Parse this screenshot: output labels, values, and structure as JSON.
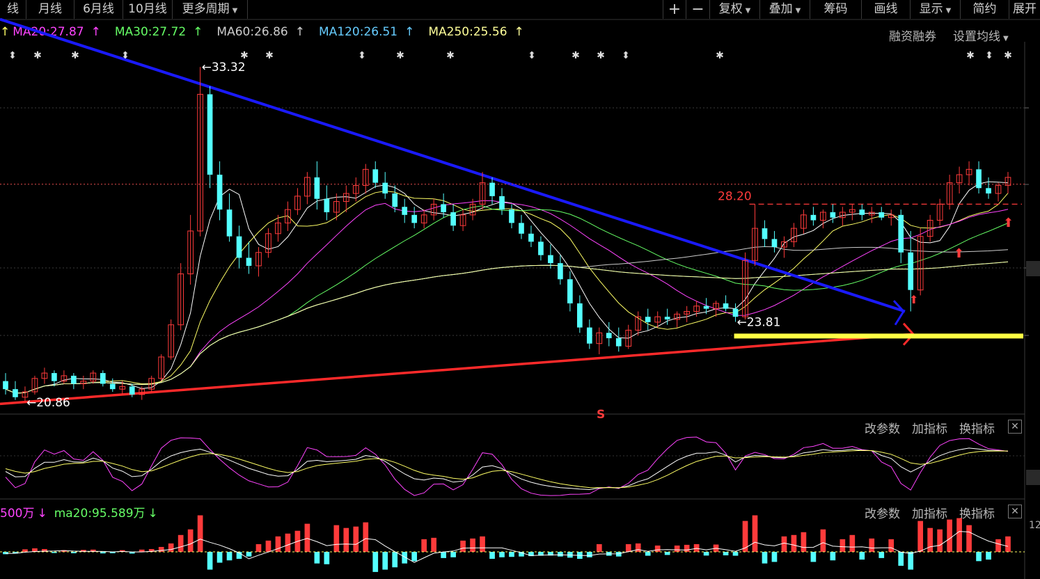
{
  "toolbar": {
    "items": [
      "线",
      "月线",
      "6月线",
      "10月线",
      "更多周期"
    ],
    "right_items": [
      "复权",
      "叠加",
      "筹码",
      "画线",
      "显示",
      "简约",
      "展开"
    ],
    "plus": "+",
    "minus": "−"
  },
  "ma_legend": {
    "ma20": "MA20:27.87",
    "ma30": "MA30:27.72",
    "ma60": "MA60:26.86",
    "ma120": "MA120:26.51",
    "ma250": "MA250:25.56",
    "lead_arrow": "↑",
    "up_arrow": "↑"
  },
  "right_links": {
    "margin": "融资融券",
    "set_ma": "设置均线"
  },
  "annotations": {
    "high": "33.32",
    "low": "20.86",
    "level_28": "28.20",
    "level_23": "23.81",
    "s_marker": "S"
  },
  "indicator_controls": {
    "edit": "改参数",
    "add": "加指标",
    "switch": "换指标",
    "close": "✕"
  },
  "volume_legend": {
    "vol": "500万",
    "vol_arrow": "↓",
    "ma20": "ma20:95.589万",
    "ma20_arrow": "↓",
    "axis_label": "12"
  },
  "colors": {
    "up": "#ff3b3b",
    "down": "#54ffff",
    "ma5": "#ffffff",
    "ma10": "#ffff66",
    "ma20": "#ff44ff",
    "ma30": "#66ff66",
    "ma60": "#cccccc",
    "ma120": "#66ccff",
    "ma250": "#ffff99",
    "trend_blue": "#1a1aff",
    "trend_red": "#ff2a2a",
    "support_yellow": "#ffff44"
  },
  "chart_data": {
    "type": "candlestick",
    "title": "",
    "price_ylim": [
      20.5,
      34.0
    ],
    "ma_values": {
      "MA20": 27.87,
      "MA30": 27.72,
      "MA60": 26.86,
      "MA120": 26.51,
      "MA250": 25.56
    },
    "key_levels": [
      {
        "label": "33.32",
        "value": 33.32
      },
      {
        "label": "20.86",
        "value": 20.86
      },
      {
        "label": "28.20",
        "value": 28.2
      },
      {
        "label": "23.81",
        "value": 23.81
      }
    ],
    "bars": [
      {
        "o": 21.6,
        "h": 21.9,
        "l": 21.1,
        "c": 21.3
      },
      {
        "o": 21.3,
        "h": 21.6,
        "l": 20.9,
        "c": 21.0
      },
      {
        "o": 21.0,
        "h": 21.4,
        "l": 20.86,
        "c": 21.2
      },
      {
        "o": 21.2,
        "h": 21.8,
        "l": 21.1,
        "c": 21.7
      },
      {
        "o": 21.7,
        "h": 22.1,
        "l": 21.5,
        "c": 21.9
      },
      {
        "o": 21.9,
        "h": 22.0,
        "l": 21.4,
        "c": 21.6
      },
      {
        "o": 21.6,
        "h": 22.0,
        "l": 21.5,
        "c": 21.8
      },
      {
        "o": 21.8,
        "h": 21.9,
        "l": 21.3,
        "c": 21.5
      },
      {
        "o": 21.5,
        "h": 21.8,
        "l": 21.3,
        "c": 21.6
      },
      {
        "o": 21.6,
        "h": 22.0,
        "l": 21.5,
        "c": 21.9
      },
      {
        "o": 21.9,
        "h": 22.0,
        "l": 21.4,
        "c": 21.5
      },
      {
        "o": 21.5,
        "h": 21.7,
        "l": 21.2,
        "c": 21.3
      },
      {
        "o": 21.3,
        "h": 21.6,
        "l": 21.1,
        "c": 21.4
      },
      {
        "o": 21.4,
        "h": 21.5,
        "l": 21.0,
        "c": 21.1
      },
      {
        "o": 21.1,
        "h": 21.4,
        "l": 20.9,
        "c": 21.3
      },
      {
        "o": 21.3,
        "h": 21.8,
        "l": 21.2,
        "c": 21.7
      },
      {
        "o": 21.7,
        "h": 22.6,
        "l": 21.6,
        "c": 22.5
      },
      {
        "o": 22.5,
        "h": 23.9,
        "l": 22.4,
        "c": 23.7
      },
      {
        "o": 23.7,
        "h": 26.0,
        "l": 23.5,
        "c": 25.6
      },
      {
        "o": 25.6,
        "h": 27.8,
        "l": 25.2,
        "c": 27.2
      },
      {
        "o": 27.2,
        "h": 33.32,
        "l": 27.0,
        "c": 32.3
      },
      {
        "o": 32.3,
        "h": 32.6,
        "l": 28.8,
        "c": 29.3
      },
      {
        "o": 29.3,
        "h": 29.8,
        "l": 27.6,
        "c": 28.0
      },
      {
        "o": 28.0,
        "h": 28.6,
        "l": 26.8,
        "c": 27.0
      },
      {
        "o": 27.0,
        "h": 27.4,
        "l": 25.8,
        "c": 26.2
      },
      {
        "o": 26.2,
        "h": 26.8,
        "l": 25.6,
        "c": 25.9
      },
      {
        "o": 25.9,
        "h": 26.6,
        "l": 25.5,
        "c": 26.4
      },
      {
        "o": 26.4,
        "h": 27.3,
        "l": 26.2,
        "c": 27.1
      },
      {
        "o": 27.1,
        "h": 27.8,
        "l": 26.8,
        "c": 27.5
      },
      {
        "o": 27.5,
        "h": 28.3,
        "l": 27.2,
        "c": 28.0
      },
      {
        "o": 28.0,
        "h": 28.8,
        "l": 27.8,
        "c": 28.5
      },
      {
        "o": 28.5,
        "h": 29.4,
        "l": 28.2,
        "c": 29.2
      },
      {
        "o": 29.2,
        "h": 29.8,
        "l": 28.0,
        "c": 28.4
      },
      {
        "o": 28.4,
        "h": 28.9,
        "l": 27.6,
        "c": 27.9
      },
      {
        "o": 27.9,
        "h": 28.6,
        "l": 27.6,
        "c": 28.3
      },
      {
        "o": 28.3,
        "h": 28.9,
        "l": 27.9,
        "c": 28.6
      },
      {
        "o": 28.6,
        "h": 29.2,
        "l": 28.3,
        "c": 28.9
      },
      {
        "o": 28.9,
        "h": 29.7,
        "l": 28.6,
        "c": 29.5
      },
      {
        "o": 29.5,
        "h": 29.8,
        "l": 28.8,
        "c": 29.0
      },
      {
        "o": 29.0,
        "h": 29.4,
        "l": 28.4,
        "c": 28.6
      },
      {
        "o": 28.6,
        "h": 28.9,
        "l": 27.9,
        "c": 28.1
      },
      {
        "o": 28.1,
        "h": 28.4,
        "l": 27.5,
        "c": 27.8
      },
      {
        "o": 27.8,
        "h": 28.1,
        "l": 27.3,
        "c": 27.5
      },
      {
        "o": 27.5,
        "h": 28.0,
        "l": 27.3,
        "c": 27.8
      },
      {
        "o": 27.8,
        "h": 28.4,
        "l": 27.6,
        "c": 28.2
      },
      {
        "o": 28.2,
        "h": 28.6,
        "l": 27.7,
        "c": 27.9
      },
      {
        "o": 27.9,
        "h": 28.2,
        "l": 27.2,
        "c": 27.4
      },
      {
        "o": 27.4,
        "h": 28.0,
        "l": 27.2,
        "c": 27.8
      },
      {
        "o": 27.8,
        "h": 28.4,
        "l": 27.6,
        "c": 28.2
      },
      {
        "o": 28.2,
        "h": 29.4,
        "l": 28.0,
        "c": 29.0
      },
      {
        "o": 29.0,
        "h": 29.2,
        "l": 28.2,
        "c": 28.5
      },
      {
        "o": 28.5,
        "h": 28.8,
        "l": 27.8,
        "c": 28.0
      },
      {
        "o": 28.0,
        "h": 28.2,
        "l": 27.3,
        "c": 27.5
      },
      {
        "o": 27.5,
        "h": 27.8,
        "l": 26.9,
        "c": 27.1
      },
      {
        "o": 27.1,
        "h": 27.4,
        "l": 26.6,
        "c": 26.8
      },
      {
        "o": 26.8,
        "h": 27.0,
        "l": 26.1,
        "c": 26.3
      },
      {
        "o": 26.3,
        "h": 26.7,
        "l": 25.8,
        "c": 26.0
      },
      {
        "o": 26.0,
        "h": 26.3,
        "l": 25.2,
        "c": 25.4
      },
      {
        "o": 25.4,
        "h": 25.7,
        "l": 24.2,
        "c": 24.5
      },
      {
        "o": 24.5,
        "h": 24.8,
        "l": 23.4,
        "c": 23.6
      },
      {
        "o": 23.6,
        "h": 23.9,
        "l": 22.8,
        "c": 23.0
      },
      {
        "o": 23.0,
        "h": 23.6,
        "l": 22.6,
        "c": 23.4
      },
      {
        "o": 23.4,
        "h": 23.8,
        "l": 22.9,
        "c": 23.2
      },
      {
        "o": 23.2,
        "h": 23.6,
        "l": 22.7,
        "c": 22.9
      },
      {
        "o": 22.9,
        "h": 23.7,
        "l": 22.8,
        "c": 23.5
      },
      {
        "o": 23.5,
        "h": 24.2,
        "l": 23.3,
        "c": 24.0
      },
      {
        "o": 24.0,
        "h": 24.3,
        "l": 23.5,
        "c": 23.8
      },
      {
        "o": 23.8,
        "h": 24.2,
        "l": 23.6,
        "c": 24.0
      },
      {
        "o": 24.0,
        "h": 24.3,
        "l": 23.7,
        "c": 23.9
      },
      {
        "o": 23.9,
        "h": 24.2,
        "l": 23.6,
        "c": 24.1
      },
      {
        "o": 24.1,
        "h": 24.4,
        "l": 23.8,
        "c": 24.2
      },
      {
        "o": 24.2,
        "h": 24.6,
        "l": 24.0,
        "c": 24.4
      },
      {
        "o": 24.4,
        "h": 24.7,
        "l": 24.1,
        "c": 24.3
      },
      {
        "o": 24.3,
        "h": 24.6,
        "l": 24.0,
        "c": 24.5
      },
      {
        "o": 24.5,
        "h": 24.8,
        "l": 24.2,
        "c": 24.3
      },
      {
        "o": 24.3,
        "h": 24.5,
        "l": 23.81,
        "c": 24.0
      },
      {
        "o": 24.0,
        "h": 26.4,
        "l": 23.9,
        "c": 26.1
      },
      {
        "o": 26.1,
        "h": 28.2,
        "l": 25.9,
        "c": 27.3
      },
      {
        "o": 27.3,
        "h": 27.6,
        "l": 26.6,
        "c": 26.9
      },
      {
        "o": 26.9,
        "h": 27.2,
        "l": 26.4,
        "c": 26.6
      },
      {
        "o": 26.6,
        "h": 27.0,
        "l": 26.2,
        "c": 26.8
      },
      {
        "o": 26.8,
        "h": 27.5,
        "l": 26.6,
        "c": 27.3
      },
      {
        "o": 27.3,
        "h": 28.0,
        "l": 27.1,
        "c": 27.8
      },
      {
        "o": 27.8,
        "h": 28.1,
        "l": 27.4,
        "c": 27.6
      },
      {
        "o": 27.6,
        "h": 28.0,
        "l": 27.3,
        "c": 27.9
      },
      {
        "o": 27.9,
        "h": 28.2,
        "l": 27.5,
        "c": 27.7
      },
      {
        "o": 27.7,
        "h": 28.1,
        "l": 27.4,
        "c": 27.9
      },
      {
        "o": 27.9,
        "h": 28.2,
        "l": 27.6,
        "c": 28.0
      },
      {
        "o": 28.0,
        "h": 28.2,
        "l": 27.6,
        "c": 27.8
      },
      {
        "o": 27.8,
        "h": 28.1,
        "l": 27.5,
        "c": 27.9
      },
      {
        "o": 27.9,
        "h": 28.1,
        "l": 27.6,
        "c": 27.7
      },
      {
        "o": 27.7,
        "h": 28.0,
        "l": 27.4,
        "c": 27.8
      },
      {
        "o": 27.8,
        "h": 28.0,
        "l": 26.0,
        "c": 26.4
      },
      {
        "o": 26.4,
        "h": 27.2,
        "l": 24.2,
        "c": 25.0
      },
      {
        "o": 25.0,
        "h": 27.3,
        "l": 24.8,
        "c": 27.0
      },
      {
        "o": 27.0,
        "h": 27.8,
        "l": 26.8,
        "c": 27.6
      },
      {
        "o": 27.6,
        "h": 28.4,
        "l": 27.4,
        "c": 28.2
      },
      {
        "o": 28.2,
        "h": 29.3,
        "l": 28.0,
        "c": 29.0
      },
      {
        "o": 29.0,
        "h": 29.6,
        "l": 28.6,
        "c": 29.3
      },
      {
        "o": 29.3,
        "h": 29.8,
        "l": 28.9,
        "c": 29.5
      },
      {
        "o": 29.5,
        "h": 29.8,
        "l": 28.6,
        "c": 28.8
      },
      {
        "o": 28.8,
        "h": 29.2,
        "l": 28.4,
        "c": 28.6
      },
      {
        "o": 28.6,
        "h": 29.0,
        "l": 28.3,
        "c": 28.9
      },
      {
        "o": 28.9,
        "h": 29.4,
        "l": 28.6,
        "c": 29.2
      }
    ],
    "volume": [
      {
        "v": 30,
        "u": false
      },
      {
        "v": 22,
        "u": false
      },
      {
        "v": 18,
        "u": true
      },
      {
        "v": 25,
        "u": true
      },
      {
        "v": 20,
        "u": true
      },
      {
        "v": 15,
        "u": false
      },
      {
        "v": 12,
        "u": true
      },
      {
        "v": 18,
        "u": false
      },
      {
        "v": 14,
        "u": true
      },
      {
        "v": 16,
        "u": true
      },
      {
        "v": 20,
        "u": false
      },
      {
        "v": 18,
        "u": false
      },
      {
        "v": 12,
        "u": true
      },
      {
        "v": 22,
        "u": false
      },
      {
        "v": 16,
        "u": true
      },
      {
        "v": 20,
        "u": true
      },
      {
        "v": 35,
        "u": true
      },
      {
        "v": 60,
        "u": true
      },
      {
        "v": 120,
        "u": true
      },
      {
        "v": 160,
        "u": true
      },
      {
        "v": 260,
        "u": true
      },
      {
        "v": 230,
        "u": false
      },
      {
        "v": 140,
        "u": false
      },
      {
        "v": 110,
        "u": false
      },
      {
        "v": 90,
        "u": false
      },
      {
        "v": 60,
        "u": false
      },
      {
        "v": 55,
        "u": true
      },
      {
        "v": 80,
        "u": true
      },
      {
        "v": 110,
        "u": true
      },
      {
        "v": 130,
        "u": true
      },
      {
        "v": 150,
        "u": true
      },
      {
        "v": 200,
        "u": true
      },
      {
        "v": 150,
        "u": false
      },
      {
        "v": 160,
        "u": false
      },
      {
        "v": 190,
        "u": true
      },
      {
        "v": 170,
        "u": true
      },
      {
        "v": 180,
        "u": true
      },
      {
        "v": 210,
        "u": true
      },
      {
        "v": 260,
        "u": false
      },
      {
        "v": 230,
        "u": false
      },
      {
        "v": 200,
        "u": false
      },
      {
        "v": 150,
        "u": false
      },
      {
        "v": 120,
        "u": false
      },
      {
        "v": 90,
        "u": true
      },
      {
        "v": 100,
        "u": true
      },
      {
        "v": 80,
        "u": false
      },
      {
        "v": 70,
        "u": false
      },
      {
        "v": 80,
        "u": true
      },
      {
        "v": 95,
        "u": true
      },
      {
        "v": 110,
        "u": true
      },
      {
        "v": 90,
        "u": false
      },
      {
        "v": 70,
        "u": false
      },
      {
        "v": 65,
        "u": false
      },
      {
        "v": 60,
        "u": false
      },
      {
        "v": 55,
        "u": false
      },
      {
        "v": 50,
        "u": false
      },
      {
        "v": 48,
        "u": false
      },
      {
        "v": 60,
        "u": false
      },
      {
        "v": 75,
        "u": false
      },
      {
        "v": 90,
        "u": false
      },
      {
        "v": 70,
        "u": false
      },
      {
        "v": 55,
        "u": true
      },
      {
        "v": 50,
        "u": false
      },
      {
        "v": 60,
        "u": false
      },
      {
        "v": 55,
        "u": true
      },
      {
        "v": 60,
        "u": true
      },
      {
        "v": 50,
        "u": false
      },
      {
        "v": 45,
        "u": true
      },
      {
        "v": 40,
        "u": false
      },
      {
        "v": 45,
        "u": true
      },
      {
        "v": 50,
        "u": true
      },
      {
        "v": 55,
        "u": true
      },
      {
        "v": 48,
        "u": false
      },
      {
        "v": 52,
        "u": true
      },
      {
        "v": 45,
        "u": false
      },
      {
        "v": 50,
        "u": false
      },
      {
        "v": 220,
        "u": true
      },
      {
        "v": 260,
        "u": true
      },
      {
        "v": 150,
        "u": false
      },
      {
        "v": 130,
        "u": false
      },
      {
        "v": 110,
        "u": true
      },
      {
        "v": 120,
        "u": true
      },
      {
        "v": 140,
        "u": true
      },
      {
        "v": 130,
        "u": false
      },
      {
        "v": 160,
        "u": true
      },
      {
        "v": 110,
        "u": false
      },
      {
        "v": 90,
        "u": true
      },
      {
        "v": 120,
        "u": true
      },
      {
        "v": 100,
        "u": false
      },
      {
        "v": 95,
        "u": true
      },
      {
        "v": 80,
        "u": false
      },
      {
        "v": 90,
        "u": true
      },
      {
        "v": 180,
        "u": false
      },
      {
        "v": 230,
        "u": false
      },
      {
        "v": 220,
        "u": true
      },
      {
        "v": 170,
        "u": true
      },
      {
        "v": 160,
        "u": true
      },
      {
        "v": 230,
        "u": true
      },
      {
        "v": 240,
        "u": true
      },
      {
        "v": 190,
        "u": true
      },
      {
        "v": 120,
        "u": false
      },
      {
        "v": 100,
        "u": false
      },
      {
        "v": 90,
        "u": true
      },
      {
        "v": 110,
        "u": true
      }
    ]
  }
}
